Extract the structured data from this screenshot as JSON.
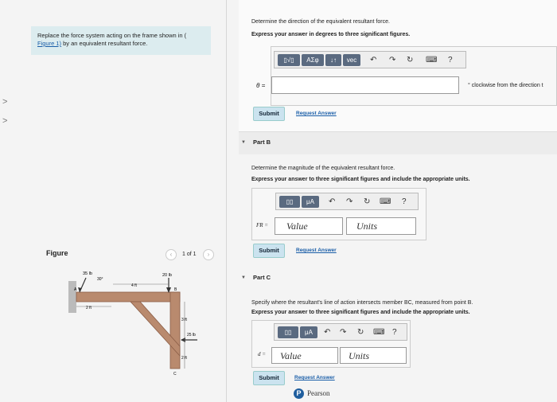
{
  "left": {
    "problem_line1": "Replace the force system acting on the frame shown in (",
    "problem_link": "Figure 1)",
    "problem_line2_rest": " by an equivalent resultant force.",
    "figure_label": "Figure",
    "pager_text": "1 of 1",
    "side_chevrons": [
      ">",
      ">"
    ]
  },
  "figure": {
    "labels": [
      "35 lb",
      "30°",
      "20 lb",
      "4 ft",
      "2 ft",
      "A",
      "B",
      "3 ft",
      "25 lb",
      "2 ft",
      "C"
    ]
  },
  "partA": {
    "question": "Determine the direction of the equivalent resultant force.",
    "instruction": "Express your answer in degrees to three significant figures.",
    "toolbar_sym1": "ΑΣφ",
    "toolbar_sym2": "↓↑",
    "toolbar_vec": "vec",
    "help": "?",
    "var_label": "θ =",
    "unit_text": "° clockwise from the direction t",
    "submit": "Submit",
    "request": "Request Answer"
  },
  "partB": {
    "title": "Part B",
    "question": "Determine the magnitude of the equivalent resultant force.",
    "instruction": "Express your answer to three significant figures and include the appropriate units.",
    "mu": "μA",
    "help": "?",
    "var_label": "FR =",
    "value_ph": "Value",
    "units_ph": "Units",
    "submit": "Submit",
    "request": "Request Answer"
  },
  "partC": {
    "title": "Part C",
    "question": "Specify where the resultant's line of action intersects member BC, measured from point B.",
    "instruction": "Express your answer to three significant figures and include the appropriate units.",
    "mu": "μA",
    "help": "?",
    "var_label": "d =",
    "value_ph": "Value",
    "units_ph": "Units",
    "submit": "Submit",
    "request": "Request Answer"
  },
  "footer": {
    "brand": "Pearson",
    "brand_letter": "P"
  }
}
